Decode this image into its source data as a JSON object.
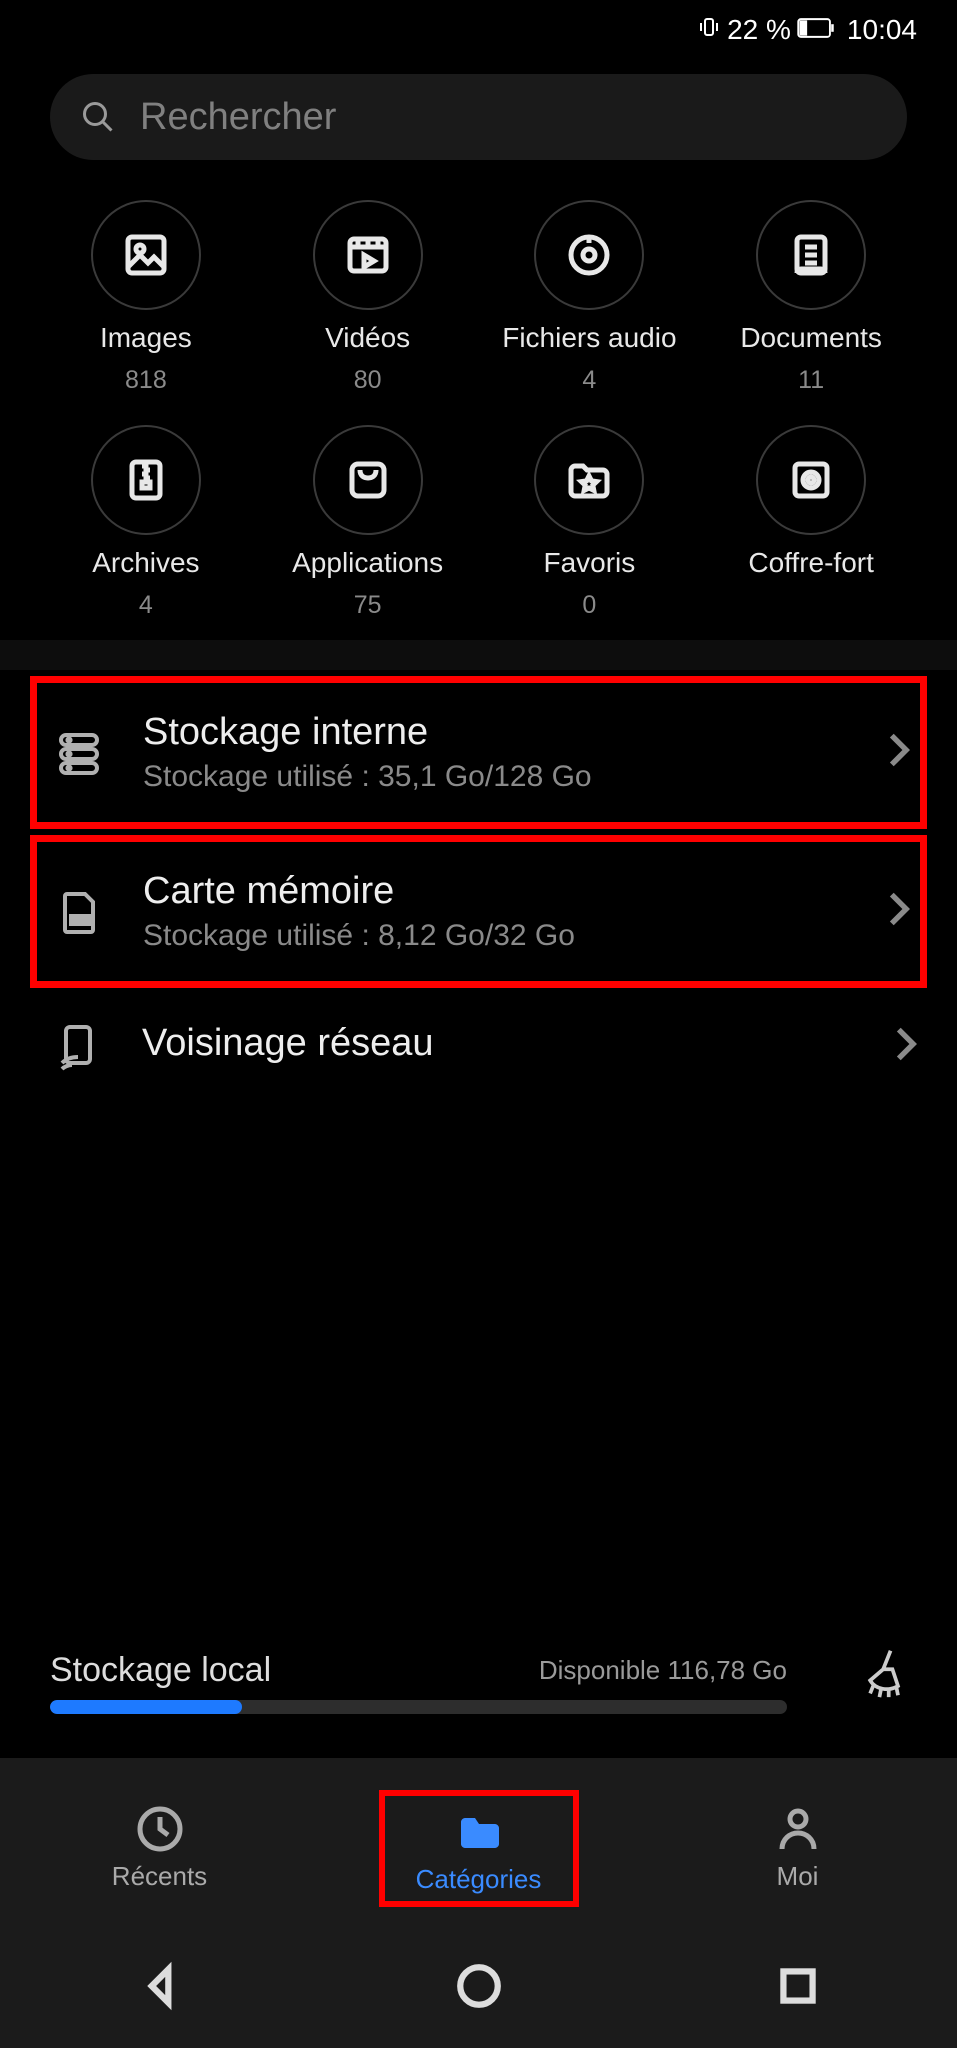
{
  "status": {
    "battery_pct": "22 %",
    "time": "10:04"
  },
  "search": {
    "placeholder": "Rechercher"
  },
  "categories": [
    {
      "icon": "image-icon",
      "label": "Images",
      "count": "818"
    },
    {
      "icon": "video-icon",
      "label": "Vidéos",
      "count": "80"
    },
    {
      "icon": "audio-icon",
      "label": "Fichiers audio",
      "count": "4"
    },
    {
      "icon": "document-icon",
      "label": "Documents",
      "count": "11"
    },
    {
      "icon": "archive-icon",
      "label": "Archives",
      "count": "4"
    },
    {
      "icon": "apps-icon",
      "label": "Applications",
      "count": "75"
    },
    {
      "icon": "favorite-icon",
      "label": "Favoris",
      "count": "0"
    },
    {
      "icon": "safe-icon",
      "label": "Coffre-fort",
      "count": ""
    }
  ],
  "storage": {
    "internal": {
      "title": "Stockage interne",
      "sub": "Stockage utilisé : 35,1 Go/128 Go"
    },
    "sdcard": {
      "title": "Carte mémoire",
      "sub": "Stockage utilisé : 8,12 Go/32 Go"
    },
    "network": {
      "title": "Voisinage réseau"
    }
  },
  "local": {
    "title": "Stockage local",
    "available": "Disponible 116,78 Go",
    "fill_pct": 26
  },
  "nav": {
    "recent": "Récents",
    "categories": "Catégories",
    "me": "Moi"
  }
}
